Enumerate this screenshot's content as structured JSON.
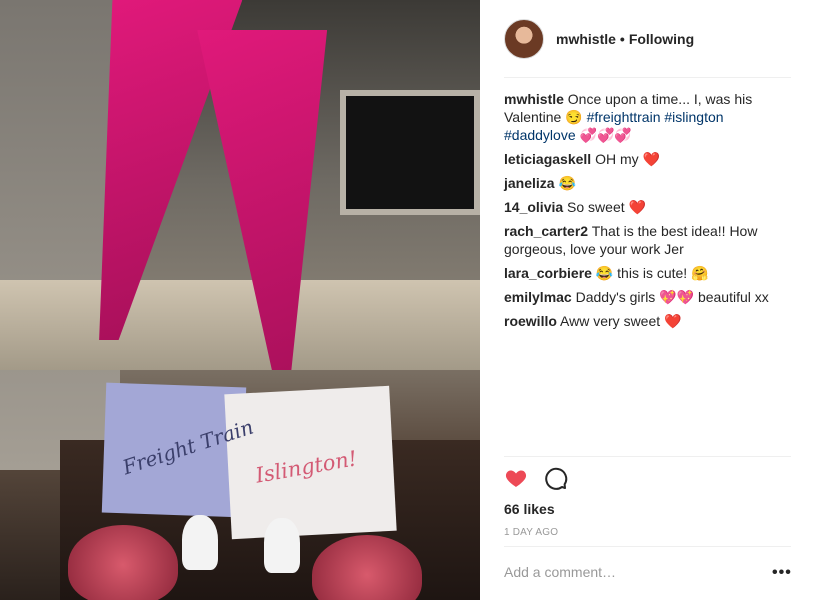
{
  "post": {
    "author": "mwhistle",
    "separator": "•",
    "follow_status": "Following",
    "avatar_icon": "profile-photo",
    "photo_text_1": "Freight Train",
    "photo_text_2": "Islington!"
  },
  "caption": {
    "user": "mwhistle",
    "text": "Once upon a time... I, was his Valentine 😏",
    "tags": [
      "#freighttrain",
      "#islington",
      "#daddylove"
    ],
    "emoji_suffix": "💞💞💞"
  },
  "comments": [
    {
      "user": "leticiagaskell",
      "text": "OH my ❤️"
    },
    {
      "user": "janeliza",
      "text": "😂"
    },
    {
      "user": "14_olivia",
      "text": "So sweet ❤️"
    },
    {
      "user": "rach_carter2",
      "text": "That is the best idea!! How gorgeous, love your work Jer"
    },
    {
      "user": "lara_corbiere",
      "text": "😂 this is cute! 🤗"
    },
    {
      "user": "emilylmac",
      "text": "Daddy's girls 💖💖 beautiful xx"
    },
    {
      "user": "roewillo",
      "text": "Aww very sweet ❤️"
    }
  ],
  "actions": {
    "like_icon": "heart-filled",
    "like_color": "#ed4956",
    "comment_icon": "speech-bubble",
    "likes": "66 likes",
    "timestamp": "1 DAY AGO"
  },
  "add_comment": {
    "placeholder": "Add a comment…",
    "more_label": "•••"
  }
}
